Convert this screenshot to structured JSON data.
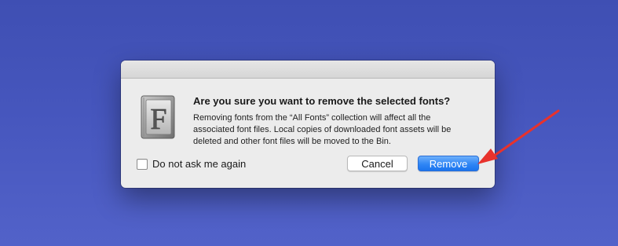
{
  "dialog": {
    "icon": "font-book-icon",
    "heading": "Are you sure you want to remove the selected fonts?",
    "message_lines": [
      "Removing fonts from the “All Fonts” collection will affect all the",
      "associated font files. Local copies of downloaded font assets will be",
      "deleted and other font files will be moved to the Bin."
    ],
    "checkbox": {
      "label": "Do not ask me again",
      "checked": false
    },
    "buttons": {
      "cancel": "Cancel",
      "remove": "Remove"
    }
  },
  "annotation": {
    "icon": "red-arrow-icon",
    "color": "#e8322c"
  },
  "colors": {
    "desktop": "#4555bc",
    "default_button": "#2f86f5"
  }
}
